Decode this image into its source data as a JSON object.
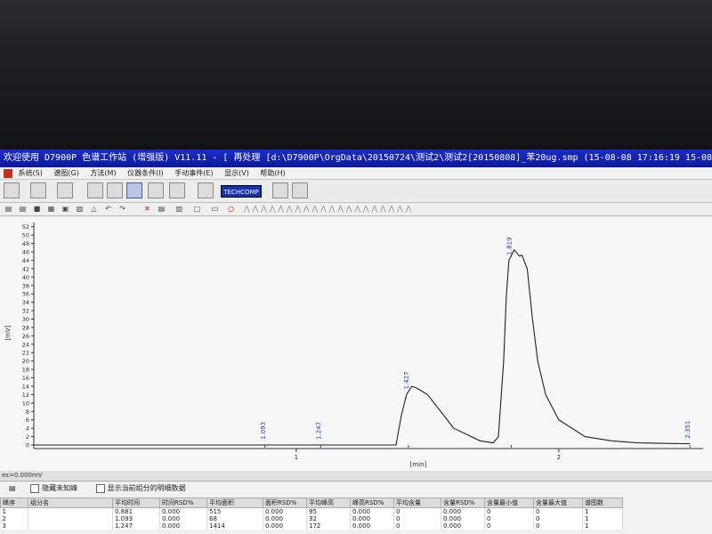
{
  "window": {
    "title": "欢迎使用 D7900P 色谱工作站 (增强版) V11.11 - [ 再处理 [d:\\D7900P\\OrgData\\20150724\\测试2\\测试2[20150808]_苯20ug.smp (15-08-08 17:16:19  15-08"
  },
  "menu": [
    "系统(S)",
    "谱图(G)",
    "方法(M)",
    "仪器条件(I)",
    "手动事件(E)",
    "显示(V)",
    "帮助(H)"
  ],
  "toolbar": {
    "logo_text": "TECHCOMP"
  },
  "chart_data": {
    "type": "line",
    "ylabel": "[mV]",
    "xlabel": "[min]",
    "ylim": [
      0,
      53
    ],
    "xlim": [
      0.0,
      2.55
    ],
    "yticks": [
      0,
      2,
      4,
      6,
      8,
      10,
      12,
      14,
      16,
      18,
      20,
      22,
      24,
      26,
      28,
      30,
      32,
      34,
      36,
      38,
      40,
      42,
      44,
      46,
      48,
      50,
      52
    ],
    "xticks": [
      {
        "value": 1,
        "label": "1"
      },
      {
        "value": 2,
        "label": "2"
      }
    ],
    "grid": false,
    "peak_labels": [
      {
        "x": 0.881,
        "label": "1.093"
      },
      {
        "x": 1.093,
        "label": "1.247"
      },
      {
        "x": 1.427,
        "label": "1.427"
      },
      {
        "x": 1.819,
        "label": "1.819"
      },
      {
        "x": 2.5,
        "label": "2.351"
      }
    ],
    "series": [
      {
        "x": [
          0.0,
          0.8,
          1.38,
          1.4,
          1.42,
          1.44,
          1.46,
          1.5,
          1.6,
          1.7,
          1.75,
          1.77,
          1.79,
          1.8,
          1.81,
          1.83,
          1.85,
          1.86,
          1.88,
          1.9,
          1.92,
          1.95,
          2.0,
          2.1,
          2.2,
          2.3,
          2.5
        ],
        "y": [
          0.0,
          0.0,
          0.0,
          7.0,
          12.0,
          14.0,
          13.5,
          12.0,
          4.0,
          1.0,
          0.5,
          2.0,
          20.0,
          35.0,
          44.0,
          46.5,
          45.0,
          45.2,
          42.0,
          30.0,
          20.0,
          12.0,
          6.0,
          2.0,
          1.0,
          0.5,
          0.3
        ]
      }
    ]
  },
  "status": {
    "left_text": "es=0.000mV"
  },
  "panel": {
    "checkbox1": "隐藏未知峰",
    "checkbox2": "显示当前组分的明细数据",
    "columns": [
      "峰序",
      "组分名",
      "平均时间",
      "时间RSD%",
      "平均面积",
      "面积RSD%",
      "平均峰高",
      "峰高RSD%",
      "平均含量",
      "含量RSD%",
      "含量最小值",
      "含量最大值",
      "谱图数"
    ],
    "rows": [
      [
        "1",
        "",
        "0.881",
        "0.000",
        "515",
        "0.000",
        "95",
        "0.000",
        "0",
        "0.000",
        "0",
        "0",
        "1"
      ],
      [
        "2",
        "",
        "1.093",
        "0.000",
        "68",
        "0.000",
        "32",
        "0.000",
        "0",
        "0.000",
        "0",
        "0",
        "1"
      ],
      [
        "3",
        "",
        "1.247",
        "0.000",
        "1414",
        "0.000",
        "172",
        "0.000",
        "0",
        "0.000",
        "0",
        "0",
        "1"
      ]
    ]
  }
}
